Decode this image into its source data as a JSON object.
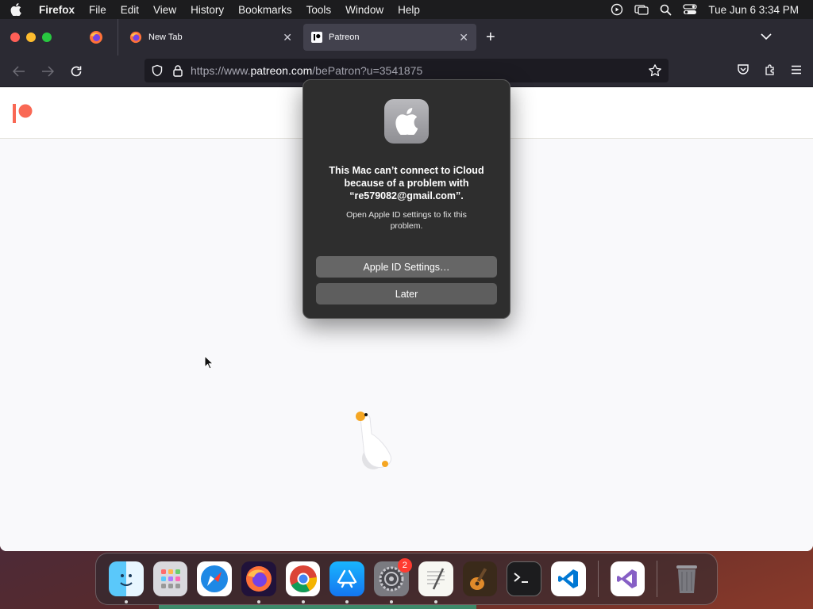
{
  "menubar": {
    "app": "Firefox",
    "items": [
      "File",
      "Edit",
      "View",
      "History",
      "Bookmarks",
      "Tools",
      "Window",
      "Help"
    ],
    "clock": "Tue Jun 6  3:34 PM"
  },
  "tabs": {
    "new_tab_title": "New Tab",
    "active_title": "Patreon"
  },
  "urlbar": {
    "url_prefix": "https://www.",
    "url_domain": "patreon.com",
    "url_path": "/bePatron?u=3541875"
  },
  "dialog": {
    "title": "This Mac can’t connect to iCloud because of a problem with “re579082@gmail.com”.",
    "message": "Open Apple ID settings to fix this problem.",
    "primary_button": "Apple ID Settings…",
    "secondary_button": "Later"
  },
  "dock": {
    "settings_badge": "2"
  },
  "colors": {
    "patreon_red": "#f96854",
    "dialog_bg": "#2e2e2e",
    "tab_bg": "#2b2a33"
  }
}
